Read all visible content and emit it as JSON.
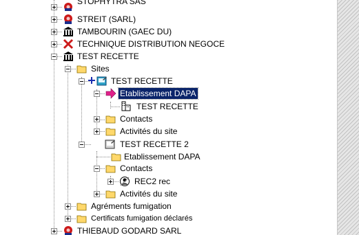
{
  "tree": {
    "nodes": [
      {
        "label": "STOPHYTRA SAS",
        "icon": "red-gear-icon",
        "expander": "plus"
      },
      {
        "label": "STREIT (SARL)",
        "icon": "red-gear-icon",
        "expander": "plus"
      },
      {
        "label": "TAMBOURIN (GAEC DU)",
        "icon": "building-icon",
        "expander": "plus"
      },
      {
        "label": "TECHNIQUE DISTRIBUTION NEGOCE",
        "icon": "red-x-icon",
        "expander": "plus"
      },
      {
        "label": "TEST RECETTE",
        "icon": "building-icon",
        "expander": "minus"
      },
      {
        "label": "Sites",
        "icon": "folder-open-icon",
        "expander": "minus"
      },
      {
        "label": "TEST RECETTE",
        "icon": "site-icon",
        "expander": "minus"
      },
      {
        "label": "Etablissement DAPA",
        "icon": "pink-arrow-icon",
        "expander": "minus",
        "selected": true
      },
      {
        "label": "TEST RECETTE",
        "icon": "establishment-icon",
        "expander": "none"
      },
      {
        "label": "Contacts",
        "icon": "folder-icon",
        "expander": "plus"
      },
      {
        "label": "Activités du site",
        "icon": "folder-icon",
        "expander": "plus"
      },
      {
        "label": "TEST RECETTE 2",
        "icon": "site-icon",
        "expander": "minus"
      },
      {
        "label": "Etablissement DAPA",
        "icon": "folder-icon",
        "expander": "none"
      },
      {
        "label": "Contacts",
        "icon": "folder-open-icon",
        "expander": "minus"
      },
      {
        "label": "REC2 rec",
        "icon": "contact-icon",
        "expander": "plus"
      },
      {
        "label": "Activités du site",
        "icon": "folder-icon",
        "expander": "plus"
      },
      {
        "label": "Agréments fumigation",
        "icon": "folder-icon",
        "expander": "plus"
      },
      {
        "label": "Certificats fumigation déclarés",
        "icon": "folder-icon",
        "expander": "plus"
      },
      {
        "label": "THIEBAUD GODARD SARL",
        "icon": "red-gear-icon",
        "expander": "plus"
      }
    ]
  },
  "colors": {
    "selection": "#0a246a",
    "folder": "#ffd86b",
    "red": "#cc1a1a",
    "pink": "#e0208a"
  }
}
